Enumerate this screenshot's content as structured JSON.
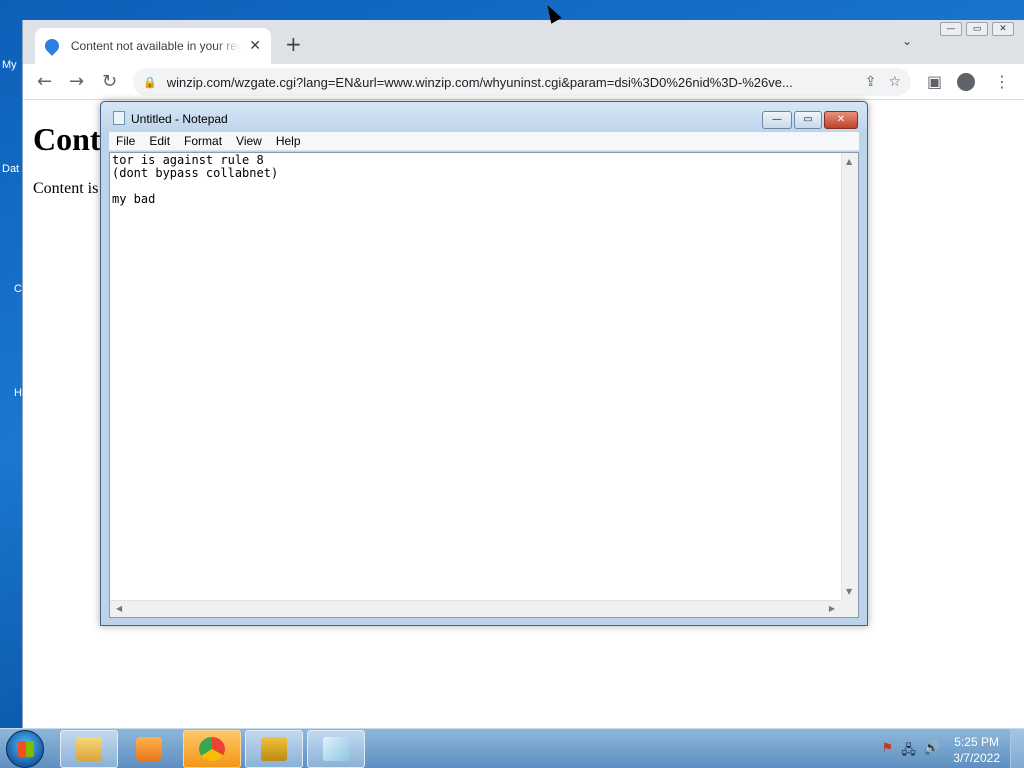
{
  "desktop": {
    "labels": [
      "My",
      "Dat",
      "C",
      "H"
    ]
  },
  "chrome": {
    "tab": {
      "title": "Content not available in your region"
    },
    "address": {
      "url": "winzip.com/wzgate.cgi?lang=EN&url=www.winzip.com/whyuninst.cgi&param=dsi%3D0%26nid%3D-%26ve..."
    },
    "page": {
      "heading": "Cont",
      "body": "Content is"
    },
    "icons": [
      "favicon-icon",
      "close-icon",
      "plus-icon",
      "chevron-down-icon",
      "back-icon",
      "forward-icon",
      "reload-icon",
      "lock-icon",
      "share-icon",
      "star-icon",
      "sidepanel-icon",
      "profile-icon",
      "menu-icon"
    ]
  },
  "notepad": {
    "title": "Untitled - Notepad",
    "menu": [
      "File",
      "Edit",
      "Format",
      "View",
      "Help"
    ],
    "content": "tor is against rule 8\n(dont bypass collabnet)\n\nmy bad"
  },
  "taskbar": {
    "time": "5:25 PM",
    "date": "3/7/2022",
    "apps": [
      "file-explorer",
      "media-player",
      "chrome",
      "winzip",
      "notepad"
    ]
  },
  "colors": {
    "desktop": "#1a78cf",
    "chrome_accent": "#dee1e6",
    "notepad_frame": "#bcd3ea",
    "taskbar": "#6f9dc8"
  }
}
